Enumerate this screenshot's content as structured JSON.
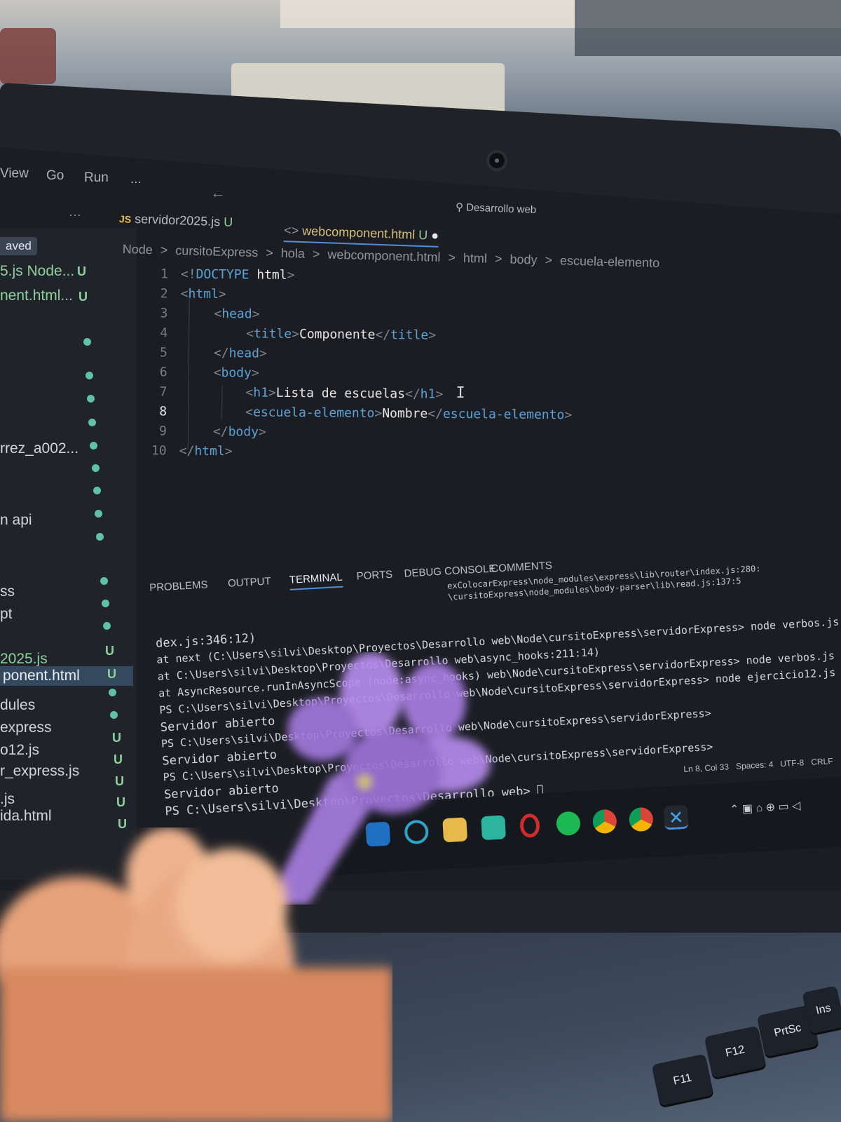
{
  "menubar": {
    "view": "View",
    "go": "Go",
    "run": "Run",
    "more": "..."
  },
  "search": {
    "label": "Desarrollo web"
  },
  "sidebar": {
    "saved": "aved",
    "items": [
      {
        "label": "5.js  Node...",
        "badge": "U"
      },
      {
        "label": "nent.html...",
        "badge": "U"
      },
      {
        "label": "rrez_a002...",
        "badge": ""
      },
      {
        "label": "n api",
        "badge": ""
      },
      {
        "label": "ss",
        "badge": ""
      },
      {
        "label": "pt",
        "badge": ""
      },
      {
        "label": "2025.js",
        "badge": "U"
      },
      {
        "label": "ponent.html",
        "badge": "U"
      },
      {
        "label": "dules",
        "badge": ""
      },
      {
        "label": "express",
        "badge": "U"
      },
      {
        "label": "o12.js",
        "badge": "U"
      },
      {
        "label": "r_express.js",
        "badge": "U"
      },
      {
        "label": ".js",
        "badge": "U"
      },
      {
        "label": "ida.html",
        "badge": "U"
      }
    ]
  },
  "tabs": {
    "tab1": {
      "icon": "JS",
      "label": "servidor2025.js",
      "badge": "U"
    },
    "tab2": {
      "label": "webcomponent.html",
      "badge": "U"
    }
  },
  "breadcrumbs": [
    "Node",
    ">",
    "cursitoExpress",
    ">",
    "hola",
    ">",
    "webcomponent.html",
    ">",
    "html",
    ">",
    "body",
    ">",
    "escuela-elemento"
  ],
  "editor": {
    "line_numbers": [
      "1",
      "2",
      "3",
      "4",
      "5",
      "6",
      "7",
      "8",
      "9",
      "10"
    ],
    "active_line": "8",
    "lines": {
      "l1": {
        "open": "<!",
        "tag": "DOCTYPE",
        "rest": " html",
        "close": ">"
      },
      "l2": {
        "open": "<",
        "tag": "html",
        "close": ">"
      },
      "l3": {
        "open": "<",
        "tag": "head",
        "close": ">"
      },
      "l4": {
        "tag": "title",
        "text": "Componente"
      },
      "l5": {
        "tag": "head"
      },
      "l6": {
        "tag": "body"
      },
      "l7": {
        "tag": "h1",
        "text": "Lista de escuelas"
      },
      "l8": {
        "tag": "escuela-elemento",
        "text": "Nombre"
      },
      "l9": {
        "tag": "body"
      },
      "l10": {
        "tag": "html"
      }
    }
  },
  "panel_tabs": [
    "PROBLEMS",
    "OUTPUT",
    "TERMINAL",
    "PORTS",
    "DEBUG CONSOLE",
    "COMMENTS"
  ],
  "terminal": {
    "top1": "exColocarExpress\\node_modules\\express\\lib\\router\\index.js:280:",
    "top2": "\\cursitoExpress\\node_modules\\body-parser\\lib\\read.js:137:5",
    "lines": [
      "dex.js:346:12)",
      "    at next (C:\\Users\\silvi\\Desktop\\Proyectos\\Desarrollo web\\Node\\cursitoExpress\\servidorExpress> node verbos.js",
      "    at C:\\Users\\silvi\\Desktop\\Proyectos\\Desarrollo web\\async_hooks:211:14)",
      "    at AsyncResource.runInAsyncScope (node:async_hooks) web\\Node\\cursitoExpress\\servidorExpress> node verbos.js",
      "PS C:\\Users\\silvi\\Desktop\\Proyectos\\Desarrollo web\\Node\\cursitoExpress\\servidorExpress> node ejercicio12.js",
      "Servidor abierto",
      "PS C:\\Users\\silvi\\Desktop\\Proyectos\\Desarrollo web\\Node\\cursitoExpress\\servidorExpress>",
      "Servidor abierto",
      "PS C:\\Users\\silvi\\Desktop\\Proyectos\\Desarrollo web\\Node\\cursitoExpress\\servidorExpress>",
      "Servidor abierto",
      "PS C:\\Users\\silvi\\Desktop\\Proyectos\\Desarrollo web>"
    ]
  },
  "statusbar": {
    "position": "Ln 8, Col 33",
    "spaces": "Spaces: 4",
    "encoding": "UTF-8",
    "eol": "CRLF"
  },
  "keyboard": {
    "f11": "F11",
    "f12": "F12",
    "prtsc": "PrtSc",
    "ins": "Ins"
  },
  "colors": {
    "tag": "#5aa3d9",
    "text": "#e6e6e6",
    "git_untracked": "#8fd19e",
    "command": "#e5d47a",
    "flower": "#a77ee0"
  }
}
